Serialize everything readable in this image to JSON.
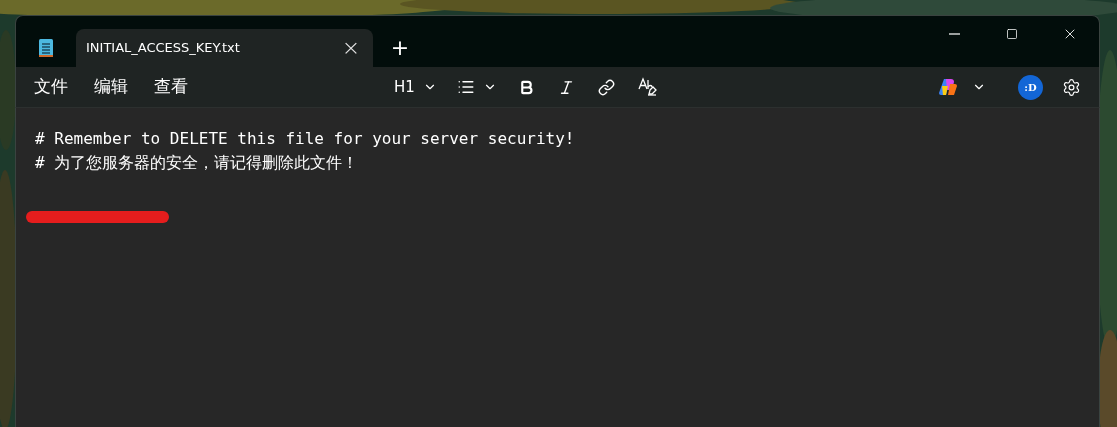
{
  "tabs": [
    {
      "title": "INITIAL_ACCESS_KEY.txt",
      "selected": true,
      "close": "×"
    }
  ],
  "new_tab": "+",
  "menu": [
    "文件",
    "编辑",
    "查看"
  ],
  "format": {
    "heading": "H1"
  },
  "avatar": ":D",
  "lines": [
    {
      "kind": "text",
      "text": "# Remember to DELETE this file for your server security!"
    },
    {
      "kind": "text",
      "text": "# 为了您服务器的安全，请记得删除此文件！"
    },
    {
      "kind": "blank"
    },
    {
      "kind": "redacted"
    }
  ]
}
